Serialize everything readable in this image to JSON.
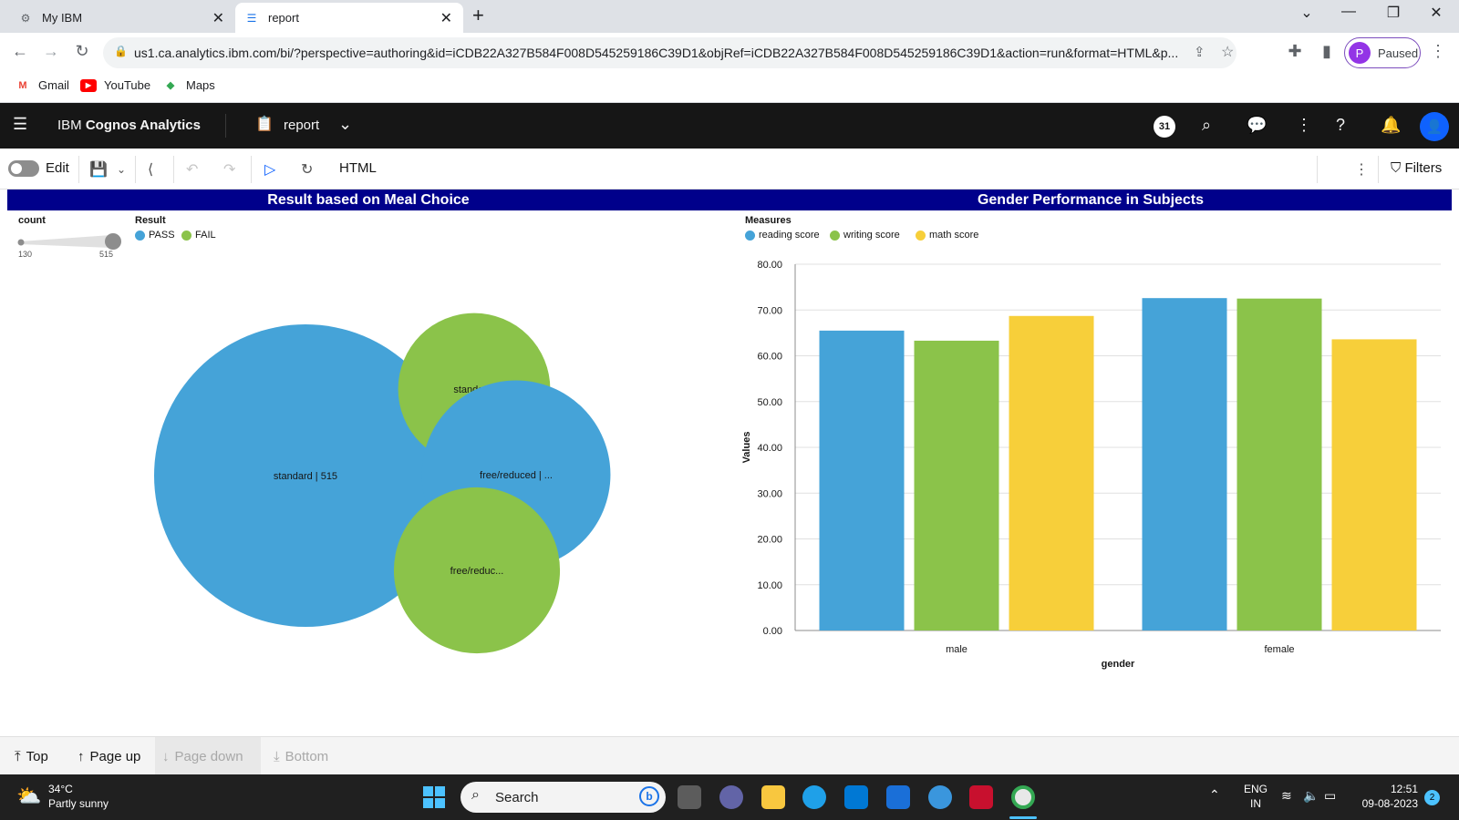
{
  "browser": {
    "tabs": [
      {
        "title": "My IBM",
        "active": false
      },
      {
        "title": "report",
        "active": true
      }
    ],
    "url": "us1.ca.analytics.ibm.com/bi/?perspective=authoring&id=iCDB22A327B584F008D545259186C39D1&objRef=iCDB22A327B584F008D545259186C39D1&action=run&format=HTML&p...",
    "profile_initial": "P",
    "profile_status": "Paused",
    "bookmarks": [
      "Gmail",
      "YouTube",
      "Maps"
    ]
  },
  "app": {
    "brand_prefix": "IBM ",
    "brand_name": "Cognos Analytics",
    "report_name": "report",
    "notification_badge": "31"
  },
  "toolbar": {
    "edit_label": "Edit",
    "format_label": "HTML",
    "filters_label": "Filters"
  },
  "report": {
    "left_title": "Result based on Meal Choice",
    "right_title": "Gender Performance in Subjects"
  },
  "chart_data": [
    {
      "type": "bubble",
      "title": "Result based on Meal Choice",
      "size_legend": {
        "title": "count",
        "min": 130,
        "max": 515,
        "min_label": "130",
        "max_label": "515"
      },
      "color_legend": {
        "title": "Result",
        "entries": [
          "PASS",
          "FAIL"
        ]
      },
      "colors": {
        "PASS": "#45a3d8",
        "FAIL": "#8bc34a"
      },
      "points": [
        {
          "label": "standard | 515",
          "lunch": "standard",
          "result": "PASS",
          "count": 515
        },
        {
          "label": "standar...",
          "lunch": "standard",
          "result": "FAIL",
          "count": 130
        },
        {
          "label": "free/reduced | ...",
          "lunch": "free/reduced",
          "result": "PASS",
          "count": 200
        },
        {
          "label": "free/reduc...",
          "lunch": "free/reduced",
          "result": "FAIL",
          "count": 155
        }
      ]
    },
    {
      "type": "bar",
      "title": "Gender Performance in Subjects",
      "legend_title": "Measures",
      "categories": [
        "male",
        "female"
      ],
      "series": [
        {
          "name": "reading score",
          "color": "#45a3d8",
          "values": [
            65.5,
            72.6
          ]
        },
        {
          "name": "writing score",
          "color": "#8bc34a",
          "values": [
            63.3,
            72.5
          ]
        },
        {
          "name": "math score",
          "color": "#f7cf3a",
          "values": [
            68.7,
            63.6
          ]
        }
      ],
      "xlabel": "gender",
      "ylabel": "Values",
      "ylim": [
        0,
        80
      ],
      "yticks": [
        "0.00",
        "10.00",
        "20.00",
        "30.00",
        "40.00",
        "50.00",
        "60.00",
        "70.00",
        "80.00"
      ],
      "grid": true
    }
  ],
  "paging": {
    "top": "Top",
    "page_up": "Page up",
    "page_down": "Page down",
    "bottom": "Bottom"
  },
  "taskbar": {
    "temperature": "34°C",
    "weather": "Partly sunny",
    "search_placeholder": "Search",
    "lang_line1": "ENG",
    "lang_line2": "IN",
    "time": "12:51",
    "date": "09-08-2023",
    "notif_count": "2"
  }
}
